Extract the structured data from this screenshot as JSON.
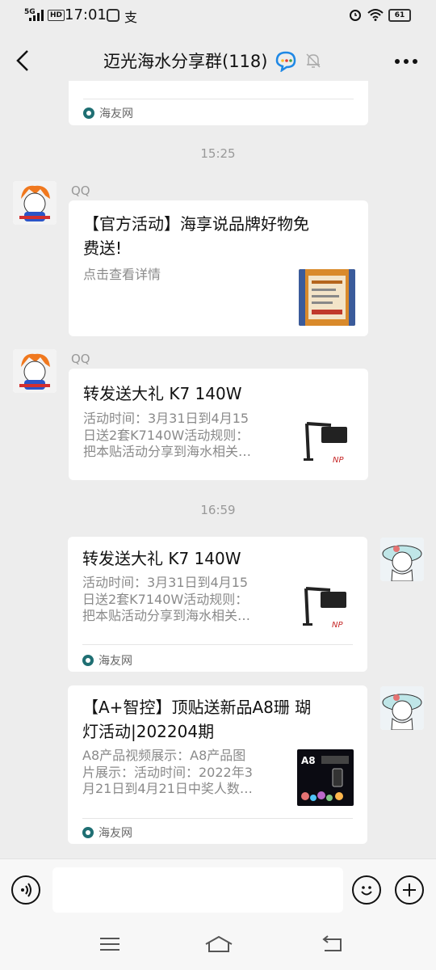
{
  "status": {
    "network": "5G",
    "hd": "HD",
    "time": "17:01",
    "battery": "61"
  },
  "header": {
    "title": "迈光海水分享群(118)"
  },
  "top_partial": {
    "source": "海友网"
  },
  "timestamps": [
    "15:25",
    "16:59"
  ],
  "messages": [
    {
      "sender": "QQ",
      "title": "【官方活动】海享说品牌好物免费送!",
      "title_line1": "【官方活动】海享说品牌好物免",
      "title_line2": "费送!",
      "desc": "点击查看详情"
    },
    {
      "sender": "QQ",
      "title": "转发送大礼 K7 140W",
      "desc_line1": "活动时间：3月31日到4月15",
      "desc_line2": "日送2套K7140W活动规则：",
      "desc_line3": "把本贴活动分享到海水相关…"
    },
    {
      "title": "转发送大礼 K7 140W",
      "desc_line1": "活动时间：3月31日到4月15",
      "desc_line2": "日送2套K7140W活动规则：",
      "desc_line3": "把本贴活动分享到海水相关…",
      "source": "海友网"
    },
    {
      "title_line1": "【A+智控】顶贴送新品A8珊 瑚",
      "title_line2": "灯活动|202204期",
      "desc_line1": "A8产品视频展示：A8产品图",
      "desc_line2": "片展示：活动时间：2022年3",
      "desc_line3": "月21日到4月21日中奖人数…",
      "thumb_label": "A8",
      "source": "海友网"
    }
  ],
  "input": {
    "placeholder": ""
  }
}
